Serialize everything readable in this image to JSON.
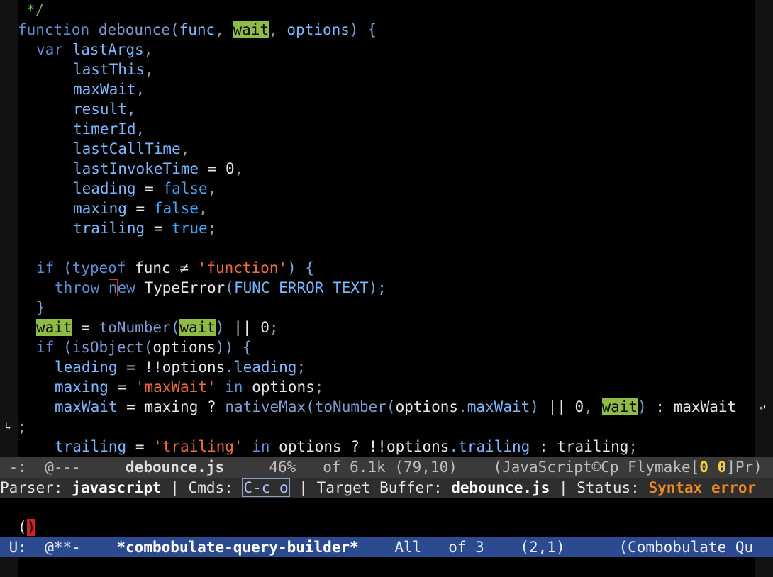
{
  "code": {
    "l01": "*/",
    "function_kw": "function",
    "fn_name": "debounce",
    "param_func": "func",
    "param_wait": "wait",
    "param_options": "options",
    "var_kw": "var",
    "v_lastArgs": "lastArgs",
    "v_lastThis": "lastThis",
    "v_maxWait": "maxWait",
    "v_result": "result",
    "v_timerId": "timerId",
    "v_lastCallTime": "lastCallTime",
    "v_lastInvokeTime": "lastInvokeTime",
    "v_leading": "leading",
    "v_maxing": "maxing",
    "v_trailing": "trailing",
    "zero": "0",
    "false": "false",
    "true": "true",
    "if_kw": "if",
    "typeof_kw": "typeof",
    "neq": "≠",
    "str_function": "'function'",
    "throw_kw": "throw",
    "new_n": "n",
    "new_ew": "ew",
    "TypeError": "TypeError",
    "FUNC_ERROR_TEXT": "FUNC_ERROR_TEXT",
    "toNumber": "toNumber",
    "isObject": "isObject",
    "not_not": "!!",
    "prop_leading": "leading",
    "str_maxWait": "'maxWait'",
    "in_kw": "in",
    "nativeMax": "nativeMax",
    "prop_maxWait": "maxWait",
    "str_trailing": "'trailing'",
    "prop_trailing": "trailing"
  },
  "modeline_main": {
    "status": "-:  @---",
    "buffer": "debounce.js",
    "percent": "46%",
    "size": "of 6.1k",
    "pos": "(79,10)",
    "mode": "(JavaScript©Cp Flymake[",
    "flymake_a": "0",
    "flymake_b": "0",
    "mode_tail": "]Pr)"
  },
  "header_line": {
    "parser_label": "Parser:",
    "parser": "javascript",
    "cmds_label": "Cmds:",
    "cmds": "C-c o",
    "target_label": "Target Buffer:",
    "target": "debounce.js",
    "status_label": "Status:",
    "status": "Syntax error"
  },
  "minibuffer": {
    "open_paren": "(",
    "cursor_char": ")"
  },
  "modeline_query": {
    "status": "U:  @**-",
    "buffer": "*combobulate-query-builder*",
    "all": "All",
    "of": "of 3",
    "pos": "(2,1)",
    "mode": "(Combobulate Qu"
  },
  "colors": {
    "background": "#000000",
    "highlight": "#8fbc45",
    "active_modeline": "#2c4a8f",
    "inactive_modeline": "#3a3a3a",
    "error_status": "#f08a1c",
    "string": "#f26b38"
  }
}
